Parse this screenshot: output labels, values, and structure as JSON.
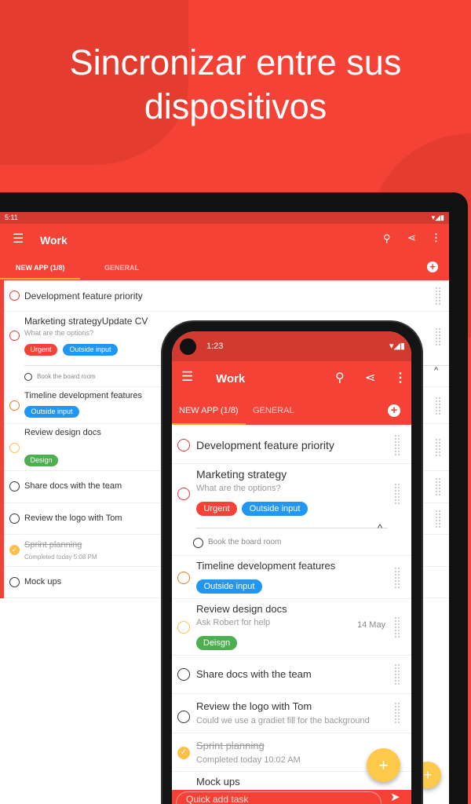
{
  "headline": [
    "Sincronizar entre sus",
    "dispositivos"
  ],
  "colors": {
    "primary": "#f44336",
    "status": "#d23a2f",
    "urgent": "#f44336",
    "outside": "#2196f3",
    "design": "#4caf50",
    "fab": "#fdc94a"
  },
  "tablet": {
    "time": "5:11",
    "title": "Work",
    "tabs": [
      "NEW APP (1/8)",
      "GENERAL"
    ],
    "tasks": [
      {
        "title": "Development feature priority"
      },
      {
        "title": "Marketing strategyUpdate CV",
        "note": "What are the options?",
        "tags": [
          "Urgent",
          "Outside input"
        ]
      },
      {
        "title": "Book the board room"
      },
      {
        "title": "Timeline development features",
        "tags": [
          "Outside input"
        ]
      },
      {
        "title": "Review design docs",
        "tags": [
          "Design"
        ]
      },
      {
        "title": "Share docs with the team"
      },
      {
        "title": "Review the logo with Tom"
      },
      {
        "title": "Sprint planning",
        "note": "Completed today 5:08 PM",
        "done": true
      },
      {
        "title": "Mock ups"
      }
    ]
  },
  "phone": {
    "time": "1:23",
    "title": "Work",
    "tabs": [
      "NEW APP (1/8)",
      "GENERAL"
    ],
    "tasks": [
      {
        "title": "Development feature priority"
      },
      {
        "title": "Marketing strategy",
        "note": "What are the options?",
        "tags": [
          "Urgent",
          "Outside input"
        ]
      },
      {
        "title": "Book the board room"
      },
      {
        "title": "Timeline development features",
        "tags": [
          "Outside input"
        ]
      },
      {
        "title": "Review design docs",
        "note": "Ask Robert for help",
        "date": "14 May",
        "tags": [
          "Deisgn"
        ]
      },
      {
        "title": "Share docs with the team"
      },
      {
        "title": "Review the logo with Tom",
        "note": "Could we use a gradiet fill for the background"
      },
      {
        "title": "Sprint planning",
        "note": "Completed today 10:02 AM",
        "done": true
      },
      {
        "title": "Mock ups"
      }
    ],
    "quick_add_placeholder": "Quick add task"
  }
}
